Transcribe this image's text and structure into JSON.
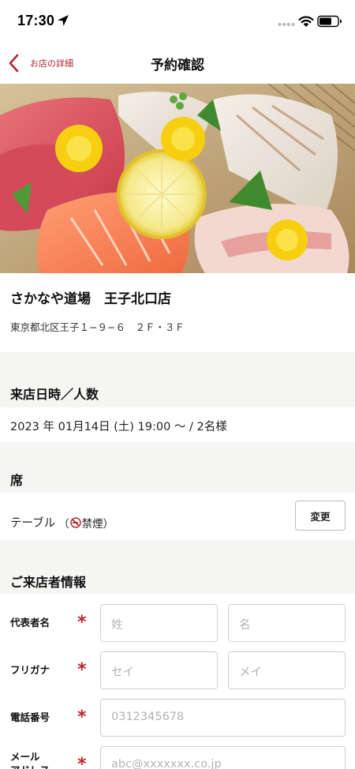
{
  "status_bar": {
    "time": "17:30"
  },
  "nav": {
    "back_label": "お店の詳細",
    "title": "予約確認"
  },
  "shop": {
    "name": "さかなや道場　王子北口店",
    "address": "東京都北区王子１−９−６　２Ｆ・３Ｆ"
  },
  "visit": {
    "heading": "来店日時／人数",
    "value": "2023 年 01月14日 (土) 19:00 〜 / 2名様"
  },
  "seat": {
    "heading": "席",
    "type": "テーブル",
    "note_open": "（",
    "note_text": "禁煙",
    "note_close": "）",
    "change_label": "変更"
  },
  "guest": {
    "heading": "ご来店者情報",
    "required_mark": "*",
    "name_label": "代表者名",
    "last_name_placeholder": "姓",
    "first_name_placeholder": "名",
    "kana_label": "フリガナ",
    "last_kana_placeholder": "セイ",
    "first_kana_placeholder": "メイ",
    "phone_label": "電話番号",
    "phone_placeholder": "0312345678",
    "email_label": "メール\nアドレス",
    "email_placeholder": "abc@xxxxxxx.co.jp"
  },
  "colors": {
    "accent": "#b5232f",
    "required": "#c0242c",
    "section_bg": "#f5f5f3"
  },
  "icons": [
    "location-arrow-icon",
    "signal-icon",
    "wifi-icon",
    "battery-icon",
    "back-chevron-icon",
    "no-smoking-icon"
  ]
}
